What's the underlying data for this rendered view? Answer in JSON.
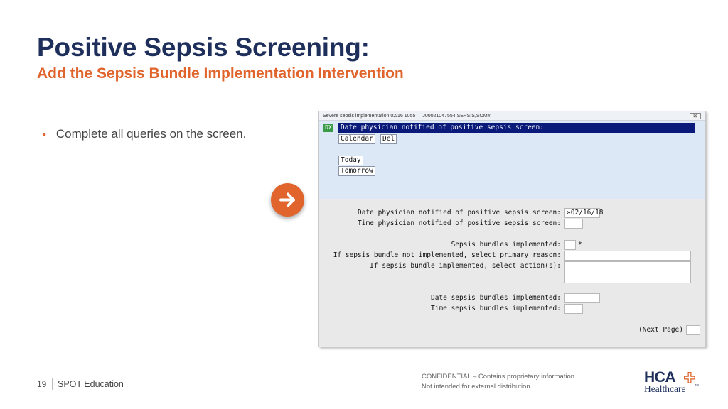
{
  "slide": {
    "title": "Positive Sepsis Screening:",
    "subtitle": "Add the Sepsis Bundle Implementation Intervention",
    "bullet": "Complete all queries on the screen.",
    "bullet_marker": "•",
    "arrow_icon": "right-arrow-icon"
  },
  "window": {
    "title_parts": [
      "Severe sepsis implementation 02/16 1055",
      "J00021047554 SEPSIS,SOMY"
    ],
    "close_label": "⊠",
    "icon_label": "DX",
    "prompt": "Date physician notified of positive sepsis screen:",
    "options": {
      "calendar": "Calendar",
      "del": "Del",
      "today": "Today",
      "tomorrow": "Tomorrow"
    },
    "form": {
      "date_notified_label": "Date physician notified of positive sepsis screen:",
      "date_notified_value": "»02/16/18",
      "time_notified_label": "Time physician notified of positive sepsis screen:",
      "time_notified_value": "",
      "bundles_implemented_label": "Sepsis bundles implemented:",
      "bundles_implemented_required": "*",
      "not_implemented_label": "If sepsis bundle not implemented, select primary reason:",
      "implemented_actions_label": "If sepsis bundle implemented, select action(s):",
      "date_bundles_label": "Date sepsis bundles implemented:",
      "time_bundles_label": "Time sepsis bundles implemented:",
      "next_page_label": "(Next Page)"
    }
  },
  "footer": {
    "page_number": "19",
    "org": "SPOT Education",
    "confidential_line1": "CONFIDENTIAL – Contains proprietary information.",
    "confidential_line2": "Not intended for external distribution.",
    "logo_top": "HCA",
    "logo_bottom": "Healthcare",
    "logo_tm": "™"
  },
  "colors": {
    "title": "#1f2f5c",
    "accent": "#e0642b",
    "prompt_bar": "#0a1a7a",
    "prompt_area": "#dce8f6",
    "dx_icon": "#3a9a48"
  }
}
